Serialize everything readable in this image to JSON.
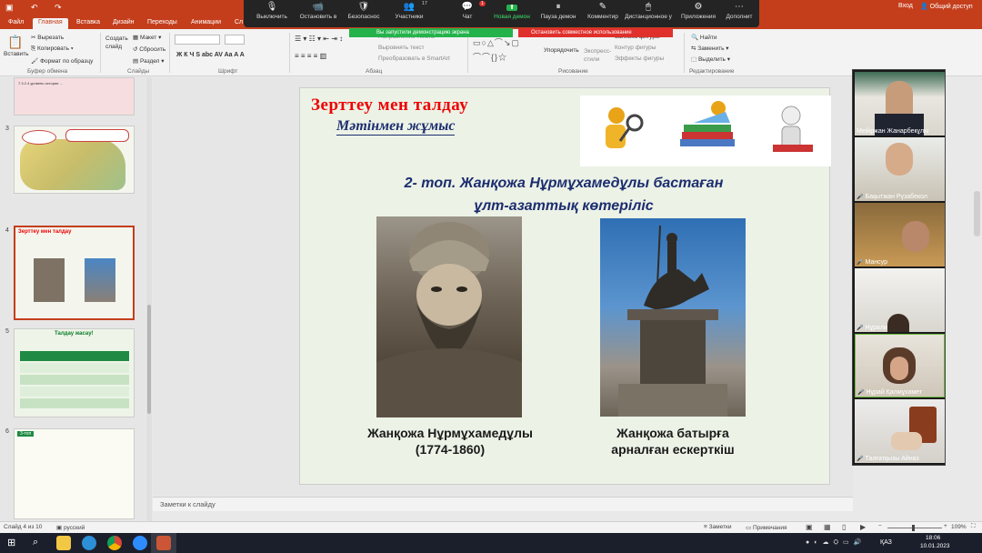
{
  "window": {
    "right_signin": "Вход",
    "right_share": "Общий доступ"
  },
  "ribbon_tabs": [
    "Файл",
    "Главная",
    "Вставка",
    "Дизайн",
    "Переходы",
    "Анимации",
    "Сл"
  ],
  "ribbon": {
    "paste": "Вставить",
    "cut": "Вырезать",
    "copy": "Копировать",
    "format_painter": "Формат по образцу",
    "create_slide": "Создать слайд",
    "layout": "Макет",
    "reset": "Сбросить",
    "section": "Раздел",
    "group_clipboard": "Буфер обмена",
    "group_slides": "Слайды",
    "group_font": "Шрифт",
    "group_paragraph": "Абзац",
    "group_drawing": "Рисование",
    "group_editing": "Редактирование",
    "text_direction": "Направление текста",
    "align_text": "Выровнять текст",
    "smartart": "Преобразовать в SmartArt",
    "arrange": "Упорядочить",
    "express_styles": "Экспресс-стили",
    "shape_fill": "Заливка фигуры",
    "shape_outline": "Контур фигуры",
    "shape_effects": "Эффекты фигуры",
    "find": "Найти",
    "replace": "Заменить",
    "select": "Выделить"
  },
  "zoom_toolbar": {
    "items": [
      {
        "label": "Выключить",
        "icon": "🎙"
      },
      {
        "label": "Остановить в",
        "icon": "📹"
      },
      {
        "label": "Безопаснос",
        "icon": "🛡"
      },
      {
        "label": "Участники",
        "icon": "👥",
        "badge": "17"
      },
      {
        "label": "Чат",
        "icon": "💬",
        "badge": "1"
      },
      {
        "label": "Новая демон",
        "icon": "⬆"
      },
      {
        "label": "Пауза демон",
        "icon": "⏸"
      },
      {
        "label": "Комментир",
        "icon": "✎"
      },
      {
        "label": "Дистанционное у",
        "icon": "🖱"
      },
      {
        "label": "Приложения",
        "icon": "⚙"
      },
      {
        "label": "Дополнит",
        "icon": "⋯"
      }
    ],
    "share_notice": "Вы запустили демонстрацию экрана",
    "stop_notice": "Остановить совместное использование"
  },
  "thumbnails": [
    {
      "number": "",
      "text": "7.3.2.4 уровень истории ...",
      "selected": false
    },
    {
      "number": "3",
      "text": "",
      "selected": false
    },
    {
      "number": "4",
      "text": "Зерттеу мен талдау",
      "selected": true
    },
    {
      "number": "5",
      "text": "Талдау жасау!",
      "selected": false
    },
    {
      "number": "6",
      "text": "3-топ",
      "selected": false
    }
  ],
  "slide": {
    "title": "Зерттеу  мен  талдау",
    "subtitle": "Мәтінмен жұмыс",
    "heading_line1": "2- топ.   Жанқожа Нұрмұхамедұлы бастаған",
    "heading_line2": "ұлт-азаттық көтеріліс",
    "caption_left_line1": "Жанқожа Нұрмұхамедұлы",
    "caption_left_line2": "(1774-1860)",
    "caption_right_line1": "Жанқожа  батырға",
    "caption_right_line2": "арналған ескерткіш"
  },
  "notes_placeholder": "Заметки к слайду",
  "status": {
    "slide_counter": "Слайд 4 из 10",
    "language": "русский",
    "notes": "Заметки",
    "comments": "Примечания",
    "zoom": "109%"
  },
  "taskbar": {
    "lang": "ҚАЗ",
    "time": "18:06",
    "date": "10.01.2023"
  },
  "participants": [
    {
      "name": "Мейіржан Жанарбекұлы",
      "muted": false,
      "active": false
    },
    {
      "name": "Бақытжан Рүзабекол",
      "muted": true,
      "active": false
    },
    {
      "name": "Мансур",
      "muted": true,
      "active": false
    },
    {
      "name": "Нұрали",
      "muted": true,
      "active": false
    },
    {
      "name": "Нұрай Қалмұхамет",
      "muted": true,
      "active": true
    },
    {
      "name": "Талғатқызы Айназ",
      "muted": true,
      "active": false
    }
  ],
  "colors": {
    "accent": "#c43e1c",
    "slide_title": "#ee0000",
    "slide_heading": "#1c2d6f",
    "zoom_green": "#24b34b",
    "zoom_red": "#e0302c"
  }
}
